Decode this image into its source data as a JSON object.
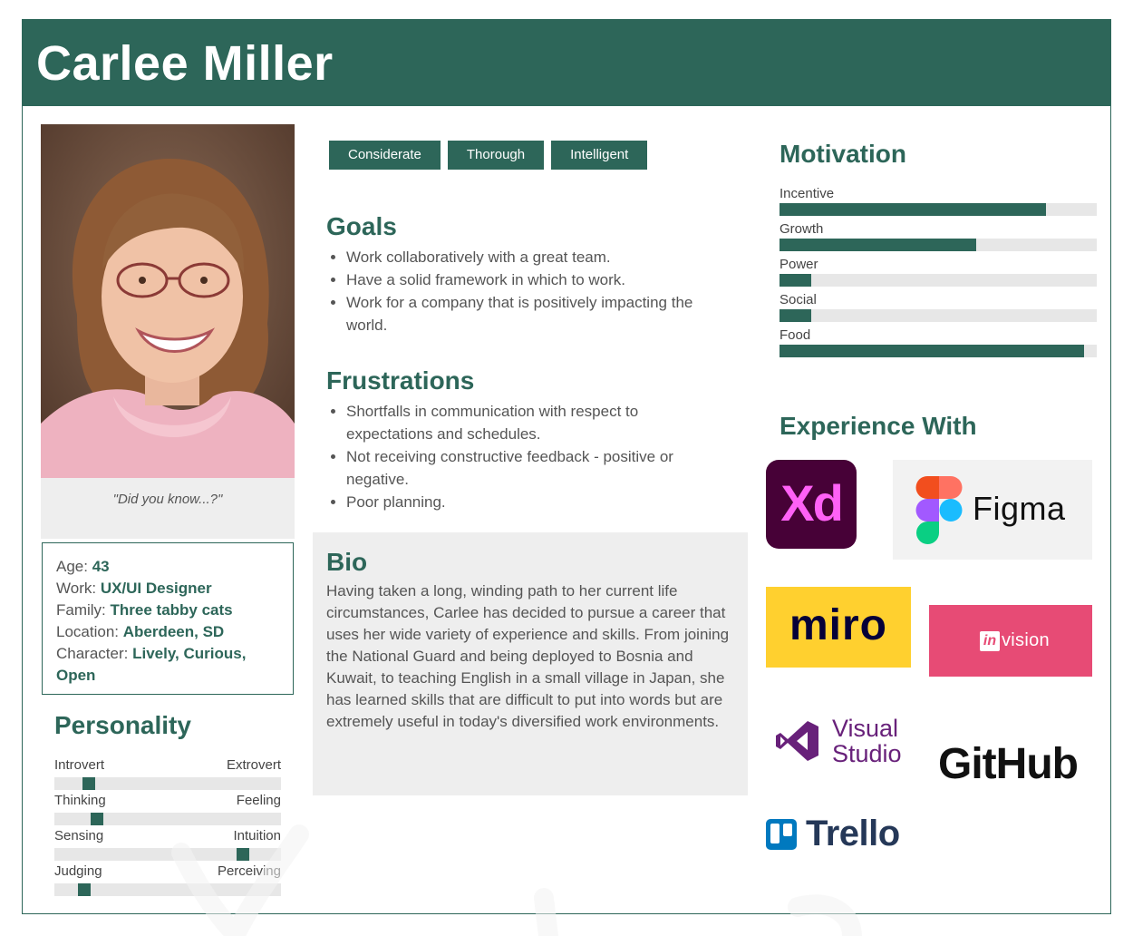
{
  "header": {
    "name": "Carlee Miller"
  },
  "photo": {
    "quote": "\"Did you know...?\""
  },
  "info": {
    "age_label": "Age:",
    "age_value": "43",
    "work_label": "Work:",
    "work_value": "UX/UI Designer",
    "family_label": "Family:",
    "family_value": "Three tabby cats",
    "location_label": "Location:",
    "location_value": "Aberdeen, SD",
    "character_label": "Character:",
    "character_value_1": "Lively, Curious,",
    "character_value_2": "Open"
  },
  "personality": {
    "title": "Personality",
    "traits": [
      {
        "left": "Introvert",
        "right": "Extrovert",
        "level": 0.13
      },
      {
        "left": "Thinking",
        "right": "Feeling",
        "level": 0.17
      },
      {
        "left": "Sensing",
        "right": "Intuition",
        "level": 0.85
      },
      {
        "left": "Judging",
        "right": "Perceiving",
        "level": 0.11
      }
    ]
  },
  "tags": [
    "Considerate",
    "Thorough",
    "Intelligent"
  ],
  "goals": {
    "title": "Goals",
    "items": [
      "Work collaboratively with a great team.",
      "Have a solid framework in which to work.",
      "Work for a company that is positively impacting the world."
    ]
  },
  "frustrations": {
    "title": "Frustrations",
    "items": [
      "Shortfalls in communication with respect to expectations and schedules.",
      "Not receiving constructive feedback - positive or negative.",
      "Poor planning."
    ]
  },
  "bio": {
    "title": "Bio",
    "text": "Having taken a long, winding path to her current life circumstances, Carlee has decided to pursue a career that uses her wide variety of experience and skills. From joining the National Guard and being deployed to Bosnia and Kuwait, to teaching English in a small village in Japan, she has learned skills that are difficult to put into words but are extremely useful in today's diversified work environments."
  },
  "motivation": {
    "title": "Motivation",
    "items": [
      {
        "label": "Incentive",
        "level": 0.84
      },
      {
        "label": "Growth",
        "level": 0.62
      },
      {
        "label": "Power",
        "level": 0.1
      },
      {
        "label": "Social",
        "level": 0.1
      },
      {
        "label": "Food",
        "level": 0.96
      }
    ]
  },
  "experience": {
    "title": "Experience With",
    "logos": {
      "xd": "Xd",
      "figma": "Figma",
      "miro": "miro",
      "invision_in": "in",
      "invision_rest": "vision",
      "vs_line1": "Visual",
      "vs_line2": "Studio",
      "github": "GitHub",
      "trello": "Trello"
    }
  },
  "colors": {
    "accent": "#2d6659",
    "track": "#e7e7e7",
    "panel": "#eeeeee"
  }
}
